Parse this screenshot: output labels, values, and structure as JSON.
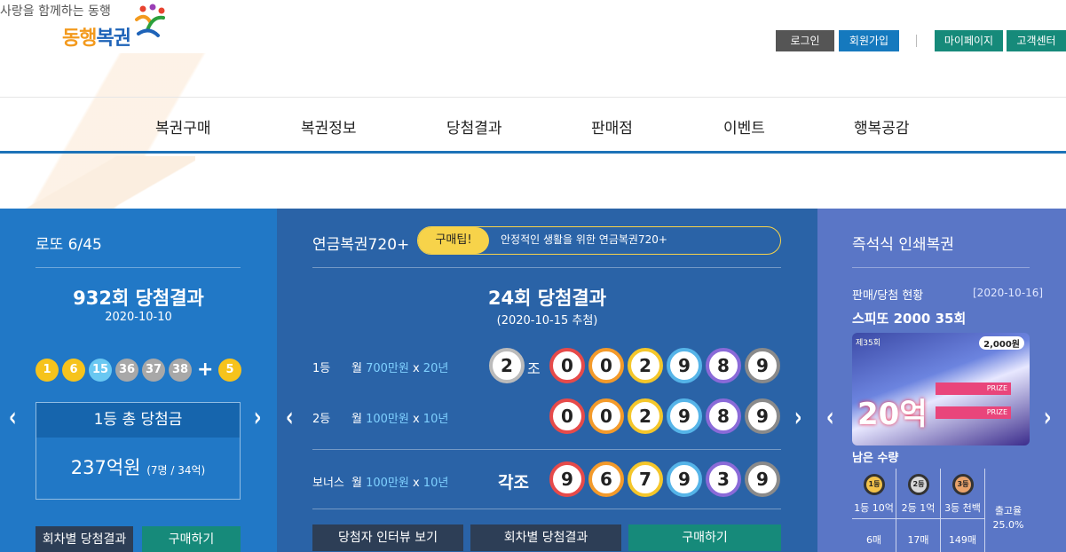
{
  "header": {
    "slogan": "사랑을 함께하는 동행",
    "logo_part1": "동행",
    "logo_part2": "복권",
    "buttons": {
      "login": "로그인",
      "join": "회원가입",
      "mypage": "마이페이지",
      "customer_center": "고객센터"
    }
  },
  "nav": [
    "복권구매",
    "복권정보",
    "당첨결과",
    "판매점",
    "이벤트",
    "행복공감"
  ],
  "lotto": {
    "title": "로또 6/45",
    "round_title": "932회 당첨결과",
    "date": "2020-10-10",
    "numbers": [
      "1",
      "6",
      "15",
      "36",
      "37",
      "38"
    ],
    "plus": "+",
    "bonus": "5",
    "prize_header": "1등 총 당첨금",
    "prize_amount": "237억원",
    "prize_detail": "(7명 / 34억)",
    "btn_results": "회차별 당첨결과",
    "btn_buy": "구매하기"
  },
  "pension": {
    "title": "연금복권720+",
    "tip_label": "구매팁!",
    "tip_text": "안정적인 생활을 위한 연금복권720+",
    "round_title": "24회 당첨결과",
    "date": "(2020-10-15 추첨)",
    "rank1": {
      "label": "1등",
      "pre": "월 ",
      "amount": "700만원",
      "mid": " x ",
      "years": "20년",
      "group": "2",
      "jo": "조",
      "digits": [
        "0",
        "0",
        "2",
        "9",
        "8",
        "9"
      ]
    },
    "rank2": {
      "label": "2등",
      "pre": "월 ",
      "amount": "100만원",
      "mid": " x ",
      "years": "10년",
      "digits": [
        "0",
        "0",
        "2",
        "9",
        "8",
        "9"
      ]
    },
    "bonus": {
      "label": "보너스",
      "pre": "월 ",
      "amount": "100만원",
      "mid": " x ",
      "years": "10년",
      "each": "각조",
      "digits": [
        "9",
        "6",
        "7",
        "9",
        "3",
        "9"
      ]
    },
    "btn_interview": "당첨자 인터뷰 보기",
    "btn_results": "회차별 당첨결과",
    "btn_buy": "구매하기"
  },
  "instant": {
    "title": "즉석식 인쇄복권",
    "status_label": "판매/당첨 현황",
    "status_date": "[2020-10-16]",
    "product": "스피또 2000 35회",
    "ticket": {
      "round": "제35회",
      "price": "2,000원",
      "big_prize": "20억",
      "prize_label": "PRIZE"
    },
    "remaining_label": "남은 수량",
    "remaining": [
      {
        "medal": "1등",
        "label": "1등 10억",
        "count": "6매"
      },
      {
        "medal": "2등",
        "label": "2등 1억",
        "count": "17매"
      },
      {
        "medal": "3등",
        "label": "3등 천백",
        "count": "149매"
      }
    ],
    "payout_label": "출고율",
    "payout_value": "25.0%"
  },
  "colors": {
    "lotto_panel": "#2178c6",
    "pension_panel": "#2a63a7",
    "instant_panel": "#5a76c6",
    "ball_yellow": "#f6c31c",
    "ball_blue": "#69c8f2",
    "ball_gray": "#a8a8a8",
    "pension_ring": [
      "#e64a4a",
      "#f39a2a",
      "#f4c62a",
      "#55b4e8",
      "#8a6ad8",
      "#8a8a8a"
    ]
  },
  "icons": [
    "logo-mark-icon",
    "chevron-left-icon",
    "chevron-right-icon",
    "medal-icon"
  ]
}
